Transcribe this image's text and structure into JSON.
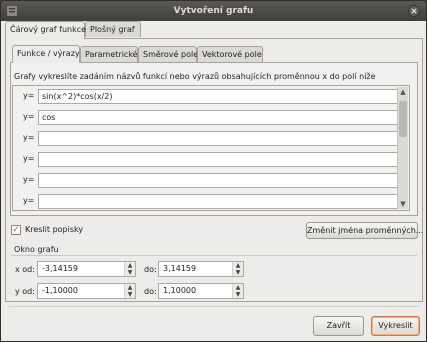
{
  "window": {
    "title": "Vytvoření grafu"
  },
  "main_tabs": [
    {
      "label": "Čárový graf funkce",
      "active": true
    },
    {
      "label": "Plošný graf",
      "active": false
    }
  ],
  "sub_tabs": [
    {
      "label": "Funkce / výrazy",
      "active": true
    },
    {
      "label": "Parametrické",
      "active": false
    },
    {
      "label": "Směrové pole",
      "active": false
    },
    {
      "label": "Vektorové pole",
      "active": false
    }
  ],
  "instructions": "Grafy vykreslíte zadáním názvů funkcí nebo výrazů obsahujících proměnnou x do polí níže",
  "function_rows": [
    {
      "label": "y=",
      "value": "sin(x^2)*cos(x/2)"
    },
    {
      "label": "y=",
      "value": "cos"
    },
    {
      "label": "y=",
      "value": ""
    },
    {
      "label": "y=",
      "value": ""
    },
    {
      "label": "y=",
      "value": ""
    },
    {
      "label": "y=",
      "value": ""
    }
  ],
  "options": {
    "draw_labels_label": "Kreslit popisky",
    "draw_labels_checked": true,
    "rename_vars_button": "Změnit jména proměnných..."
  },
  "window_group": {
    "title": "Okno grafu",
    "x_from_label": "x od:",
    "x_from": "-3,14159",
    "x_to_label": "do:",
    "x_to": "3,14159",
    "y_from_label": "y od:",
    "y_from": "-1,10000",
    "y_to_label": "do:",
    "y_to": "1,10000"
  },
  "footer": {
    "close_button": "Zavřít",
    "plot_button": "Vykreslit"
  }
}
